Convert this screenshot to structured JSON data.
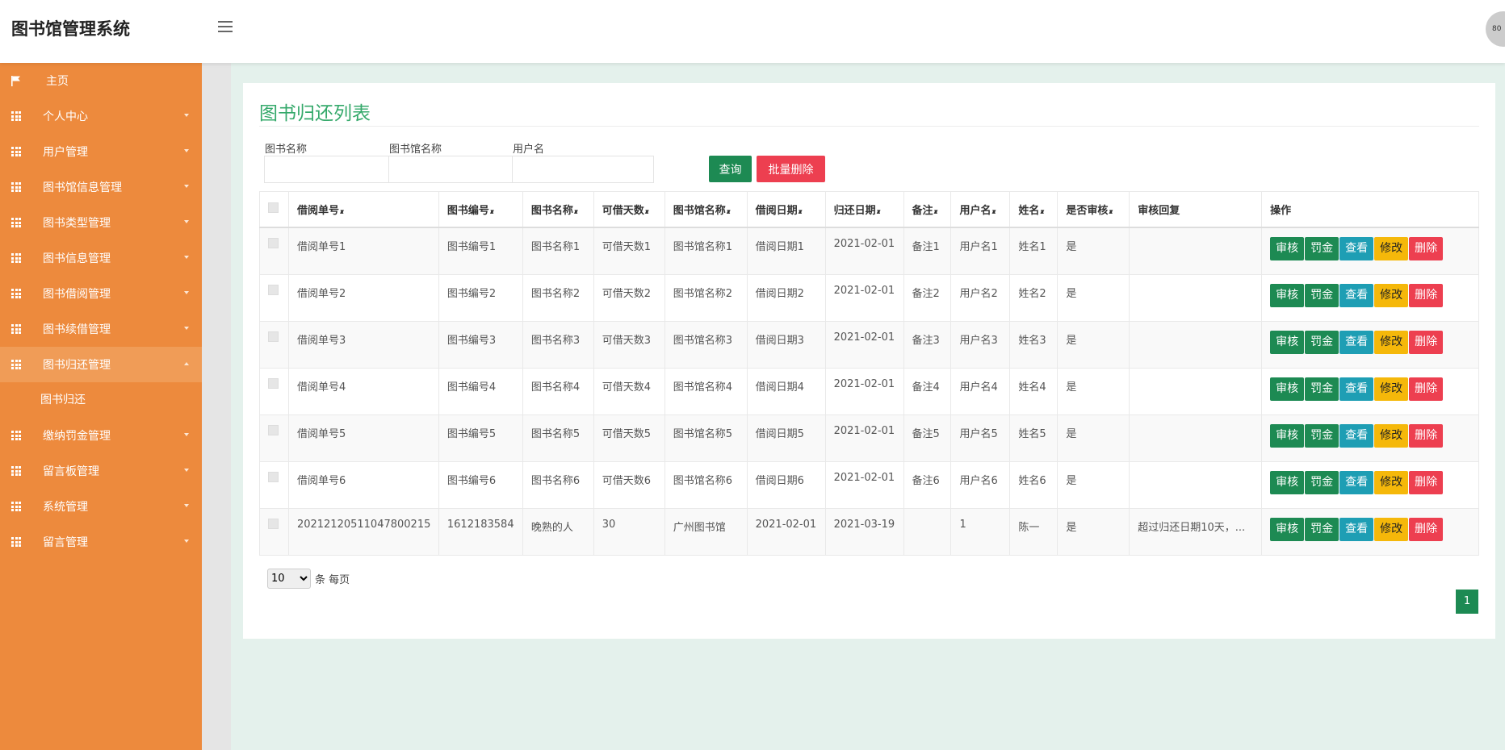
{
  "app": {
    "title": "图书馆管理系统",
    "avatar_text": "80"
  },
  "sidebar": {
    "items": [
      {
        "label": "主页",
        "icon": "flag-icon"
      },
      {
        "label": "个人中心",
        "icon": "grid-icon"
      },
      {
        "label": "用户管理",
        "icon": "grid-icon"
      },
      {
        "label": "图书馆信息管理",
        "icon": "grid-icon"
      },
      {
        "label": "图书类型管理",
        "icon": "grid-icon"
      },
      {
        "label": "图书信息管理",
        "icon": "grid-icon"
      },
      {
        "label": "图书借阅管理",
        "icon": "grid-icon"
      },
      {
        "label": "图书续借管理",
        "icon": "grid-icon"
      },
      {
        "label": "图书归还管理",
        "icon": "grid-icon",
        "expanded": true
      },
      {
        "label": "缴纳罚金管理",
        "icon": "grid-icon"
      },
      {
        "label": "留言板管理",
        "icon": "grid-icon"
      },
      {
        "label": "系统管理",
        "icon": "grid-icon"
      },
      {
        "label": "留言管理",
        "icon": "grid-icon"
      }
    ],
    "subitem": "图书归还"
  },
  "main": {
    "title": "图书归还列表",
    "search": {
      "book_name_label": "图书名称",
      "library_name_label": "图书馆名称",
      "username_label": "用户名",
      "book_name_value": "",
      "library_name_value": "",
      "username_value": "",
      "query_label": "查询",
      "batch_delete_label": "批量删除"
    },
    "table": {
      "headers": [
        "借阅单号",
        "图书编号",
        "图书名称",
        "可借天数",
        "图书馆名称",
        "借阅日期",
        "归还日期",
        "备注",
        "用户名",
        "姓名",
        "是否审核",
        "审核回复",
        "操作"
      ],
      "sortable": [
        true,
        true,
        true,
        true,
        true,
        true,
        true,
        true,
        true,
        true,
        true,
        false,
        false
      ],
      "rows": [
        [
          "借阅单号1",
          "图书编号1",
          "图书名称1",
          "可借天数1",
          "图书馆名称1",
          "借阅日期1",
          "2021-02-01",
          "备注1",
          "用户名1",
          "姓名1",
          "是",
          ""
        ],
        [
          "借阅单号2",
          "图书编号2",
          "图书名称2",
          "可借天数2",
          "图书馆名称2",
          "借阅日期2",
          "2021-02-01",
          "备注2",
          "用户名2",
          "姓名2",
          "是",
          ""
        ],
        [
          "借阅单号3",
          "图书编号3",
          "图书名称3",
          "可借天数3",
          "图书馆名称3",
          "借阅日期3",
          "2021-02-01",
          "备注3",
          "用户名3",
          "姓名3",
          "是",
          ""
        ],
        [
          "借阅单号4",
          "图书编号4",
          "图书名称4",
          "可借天数4",
          "图书馆名称4",
          "借阅日期4",
          "2021-02-01",
          "备注4",
          "用户名4",
          "姓名4",
          "是",
          ""
        ],
        [
          "借阅单号5",
          "图书编号5",
          "图书名称5",
          "可借天数5",
          "图书馆名称5",
          "借阅日期5",
          "2021-02-01",
          "备注5",
          "用户名5",
          "姓名5",
          "是",
          ""
        ],
        [
          "借阅单号6",
          "图书编号6",
          "图书名称6",
          "可借天数6",
          "图书馆名称6",
          "借阅日期6",
          "2021-02-01",
          "备注6",
          "用户名6",
          "姓名6",
          "是",
          ""
        ],
        [
          "20212120511047800215",
          "1612183584",
          "晚熟的人",
          "30",
          "广州图书馆",
          "2021-02-01",
          "2021-03-19",
          "",
          "1",
          "陈一",
          "是",
          "超过归还日期10天，..."
        ]
      ],
      "actions": [
        "审核",
        "罚金",
        "查看",
        "修改",
        "删除"
      ]
    },
    "pager": {
      "page_size": "10",
      "page_size_suffix": "条 每页",
      "current_page": "1"
    }
  },
  "colors": {
    "sidebar": "#ed8a3d",
    "accent_green": "#1d8a53",
    "title_green": "#35a96b",
    "danger": "#ed3f50",
    "info": "#1e9eb4",
    "warning": "#f5b80a",
    "background": "#e4f1ec"
  }
}
